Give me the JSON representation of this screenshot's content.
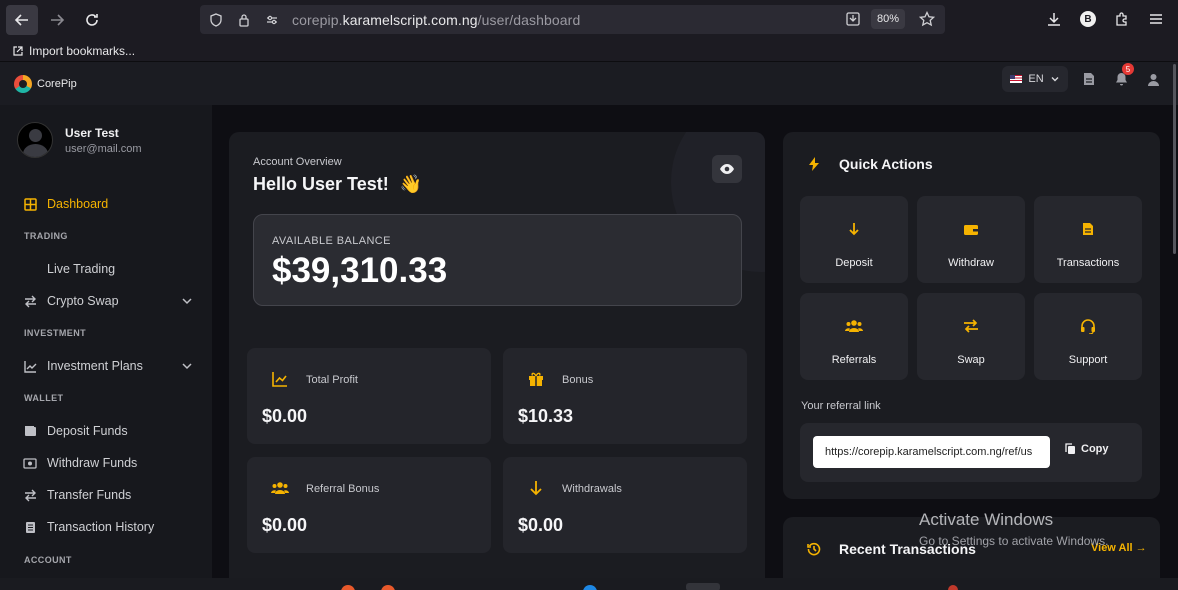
{
  "browser": {
    "url_prefix": "corepip.",
    "url_host": "karamelscript.com.ng",
    "url_path": "/user/dashboard",
    "zoom": "80%",
    "profile_initial": "B",
    "bookmark_label": "Import bookmarks..."
  },
  "app": {
    "brand": "CorePip",
    "language": "EN",
    "notification_count": "5"
  },
  "user": {
    "name": "User Test",
    "email": "user@mail.com"
  },
  "sidebar": {
    "dashboard": "Dashboard",
    "section_trading": "TRADING",
    "live_trading": "Live Trading",
    "crypto_swap": "Crypto Swap",
    "section_investment": "INVESTMENT",
    "investment_plans": "Investment Plans",
    "section_wallet": "WALLET",
    "deposit_funds": "Deposit Funds",
    "withdraw_funds": "Withdraw Funds",
    "transfer_funds": "Transfer Funds",
    "transaction_history": "Transaction History",
    "section_account": "ACCOUNT"
  },
  "overview": {
    "label": "Account Overview",
    "greeting": "Hello User Test!",
    "wave": "👋",
    "balance_label": "AVAILABLE BALANCE",
    "balance_value": "$39,310.33",
    "stats": [
      {
        "label": "Total Profit",
        "value": "$0.00"
      },
      {
        "label": "Bonus",
        "value": "$10.33"
      },
      {
        "label": "Referral Bonus",
        "value": "$0.00"
      },
      {
        "label": "Withdrawals",
        "value": "$0.00"
      }
    ]
  },
  "quick_actions": {
    "title": "Quick Actions",
    "tiles": [
      "Deposit",
      "Withdraw",
      "Transactions",
      "Referrals",
      "Swap",
      "Support"
    ],
    "referral_label": "Your referral link",
    "referral_link": "https://corepip.karamelscript.com.ng/ref/us",
    "copy_label": "Copy"
  },
  "recent_transactions": {
    "title": "Recent Transactions",
    "view_all": "View All →"
  },
  "watermark": {
    "line1": "Activate Windows",
    "line2": "Go to Settings to activate Windows."
  },
  "colors": {
    "accent": "#f5b301",
    "background": "#0e0e13",
    "card": "#1b1c21"
  }
}
